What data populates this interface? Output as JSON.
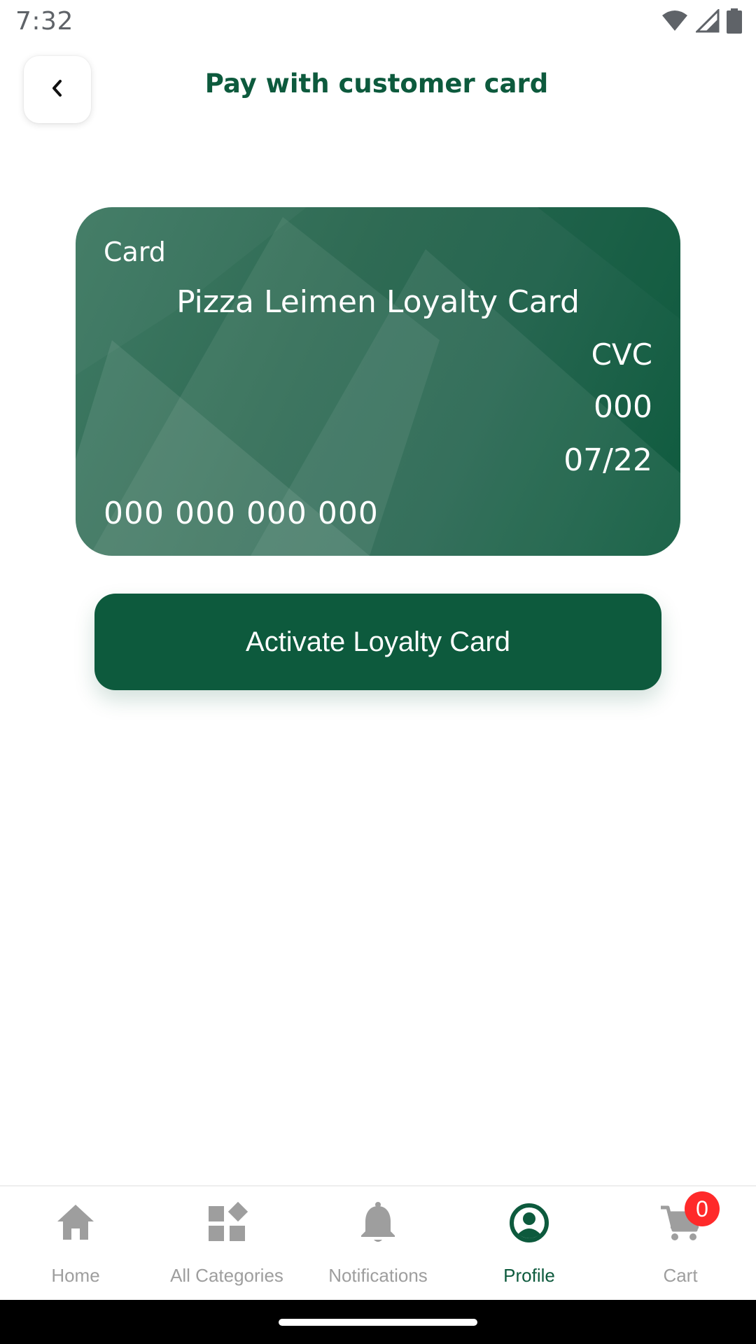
{
  "status_bar": {
    "time": "7:32",
    "icons": [
      "wifi-icon",
      "signal-icon",
      "battery-icon"
    ]
  },
  "header": {
    "back_icon": "chevron-left-icon",
    "title": "Pay with customer card"
  },
  "card": {
    "label": "Card",
    "name": "Pizza Leimen Loyalty Card",
    "cvc_label": "CVC",
    "cvc_value": "000",
    "expiry": "07/22",
    "number": "000 000 000 000",
    "colors": {
      "gradient_light": "#3f7a64",
      "gradient_dark": "#0d5a3d"
    }
  },
  "activate_button": {
    "label": "Activate Loyalty Card",
    "color": "#0d5a3d"
  },
  "bottom_nav": {
    "items": [
      {
        "label": "Home",
        "icon": "home-icon",
        "active": false
      },
      {
        "label": "All Categories",
        "icon": "categories-icon",
        "active": false
      },
      {
        "label": "Notifications",
        "icon": "bell-icon",
        "active": false
      },
      {
        "label": "Profile",
        "icon": "profile-icon",
        "active": true
      },
      {
        "label": "Cart",
        "icon": "cart-icon",
        "active": false
      }
    ],
    "cart_badge": "0",
    "active_color": "#0d5a3d",
    "inactive_color": "#9e9e9e",
    "badge_color": "#ff2a2a"
  }
}
